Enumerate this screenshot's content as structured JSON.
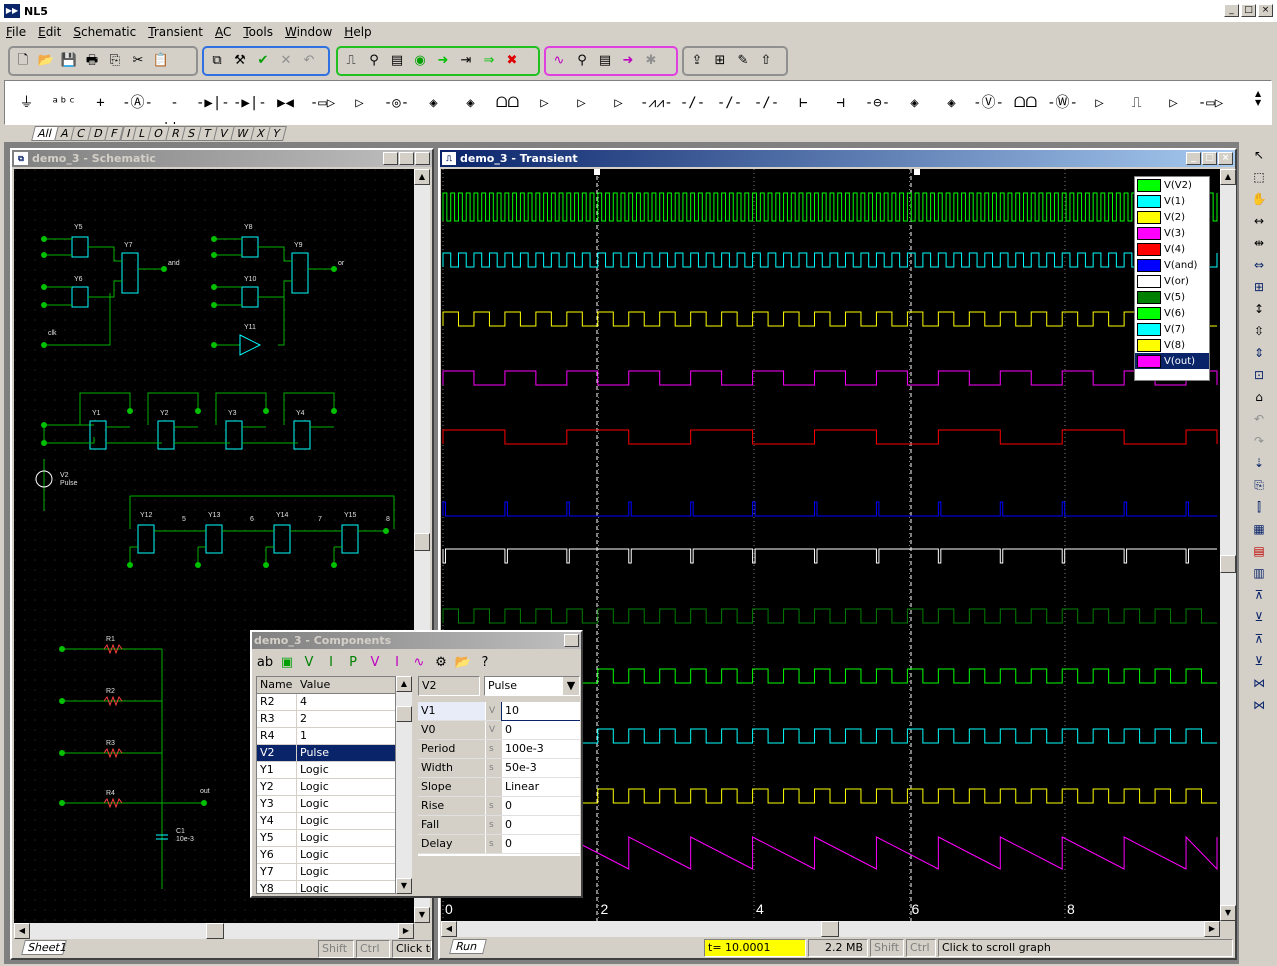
{
  "app": {
    "title": "NL5"
  },
  "menu": [
    "File",
    "Edit",
    "Schematic",
    "Transient",
    "AC",
    "Tools",
    "Window",
    "Help"
  ],
  "palette_tabs": [
    "All",
    "A",
    "C",
    "D",
    "F",
    "I",
    "L",
    "O",
    "R",
    "S",
    "T",
    "V",
    "W",
    "X",
    "Y"
  ],
  "schematic": {
    "title": "demo_3 - Schematic",
    "sheet_tab": "Sheet1",
    "status": [
      "Shift",
      "Ctrl",
      "Click to"
    ],
    "labels": [
      "Y5",
      "Y6",
      "Y7",
      "and",
      "clk",
      "Y8",
      "Y10",
      "Y9",
      "or",
      "Y11",
      "Y1",
      "Y2",
      "Y3",
      "Y4",
      "V2",
      "Pulse",
      "Y12",
      "Y13",
      "Y14",
      "Y15",
      "5",
      "6",
      "7",
      "8",
      "R1",
      "R2",
      "R3",
      "R4",
      "C1",
      "10e-3",
      "out"
    ]
  },
  "transient": {
    "title": "demo_3 - Transient",
    "tab": "Run",
    "t_value": "t= 10.0001",
    "memory": "2.2 MB",
    "shift": "Shift",
    "ctrl": "Ctrl",
    "hint": "Click to scroll graph",
    "x_ticks": [
      "0",
      "2",
      "4",
      "6",
      "8"
    ],
    "legend": [
      {
        "name": "V(V2)",
        "color": "#00ff00"
      },
      {
        "name": "V(1)",
        "color": "#00ffff"
      },
      {
        "name": "V(2)",
        "color": "#ffff00"
      },
      {
        "name": "V(3)",
        "color": "#ff00ff"
      },
      {
        "name": "V(4)",
        "color": "#ff0000"
      },
      {
        "name": "V(and)",
        "color": "#0000ff"
      },
      {
        "name": "V(or)",
        "color": "#ffffff"
      },
      {
        "name": "V(5)",
        "color": "#008000"
      },
      {
        "name": "V(6)",
        "color": "#00ff00"
      },
      {
        "name": "V(7)",
        "color": "#00ffff"
      },
      {
        "name": "V(8)",
        "color": "#ffff00"
      },
      {
        "name": "V(out)",
        "color": "#ff00ff"
      }
    ]
  },
  "components": {
    "title": "demo_3 - Components",
    "headers": [
      "Name",
      "Value"
    ],
    "rows": [
      [
        "R2",
        "4"
      ],
      [
        "R3",
        "2"
      ],
      [
        "R4",
        "1"
      ],
      [
        "V2",
        "Pulse"
      ],
      [
        "Y1",
        "Logic"
      ],
      [
        "Y2",
        "Logic"
      ],
      [
        "Y3",
        "Logic"
      ],
      [
        "Y4",
        "Logic"
      ],
      [
        "Y5",
        "Logic"
      ],
      [
        "Y6",
        "Logic"
      ],
      [
        "Y7",
        "Logic"
      ],
      [
        "Y8",
        "Logic"
      ]
    ],
    "selected_name": "V2",
    "selected_type": "Pulse",
    "params": [
      [
        "V1",
        "V",
        "10"
      ],
      [
        "V0",
        "V",
        "0"
      ],
      [
        "Period",
        "s",
        "100e-3"
      ],
      [
        "Width",
        "s",
        "50e-3"
      ],
      [
        "Slope",
        "",
        "Linear"
      ],
      [
        "Rise",
        "s",
        "0"
      ],
      [
        "Fall",
        "s",
        "0"
      ],
      [
        "Delay",
        "s",
        "0"
      ]
    ]
  }
}
